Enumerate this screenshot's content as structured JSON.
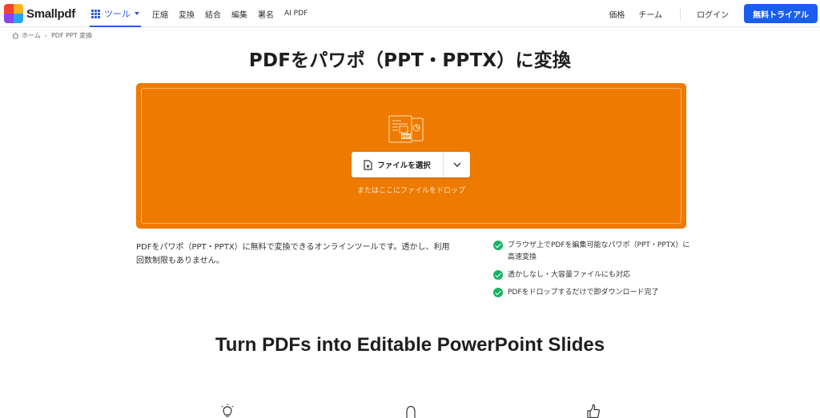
{
  "brand": {
    "name": "Smallpdf",
    "colors": [
      "#f5412c",
      "#ffb31a",
      "#8e44ec",
      "#25a6f0"
    ]
  },
  "nav": {
    "tools_label": "ツール",
    "items": [
      "圧縮",
      "変換",
      "結合",
      "編集",
      "署名"
    ],
    "ai_label": "AI PDF",
    "pricing": "価格",
    "team": "チーム",
    "login": "ログイン",
    "trial": "無料トライアル"
  },
  "breadcrumb": {
    "home": "ホーム",
    "current": "PDF PPT 変換"
  },
  "page": {
    "title": "PDFをパワポ（PPT・PPTX）に変換"
  },
  "dropzone": {
    "button_label": "ファイルを選択",
    "hint": "またはここにファイルをドロップ",
    "accent": "#ee7a00",
    "pdf_tag": "PDF"
  },
  "description": {
    "text": "PDFをパワポ（PPT・PPTX）に無料で変換できるオンラインツールです。透かし、利用回数制限もありません。"
  },
  "features": [
    "ブラウザ上でPDFを編集可能なパワポ（PPT・PPTX）に高速変換",
    "透かしなし・大容量ファイルにも対応",
    "PDFをドロップするだけで即ダウンロード完了"
  ],
  "section": {
    "title": "Turn PDFs into Editable PowerPoint Slides",
    "icons": [
      "lightbulb-icon",
      "lock-icon",
      "thumbs-up-icon"
    ]
  }
}
